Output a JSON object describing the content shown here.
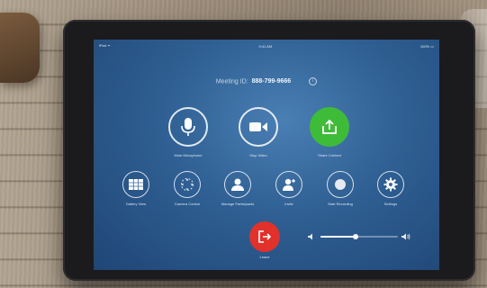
{
  "status": {
    "left": "iPad ᯤ",
    "time": "9:41 AM",
    "battery": "100% ▭"
  },
  "meeting": {
    "label": "Meeting ID:",
    "id": "888-799-9666"
  },
  "primary": [
    {
      "label": "Mute Microphone"
    },
    {
      "label": "Stop Video"
    },
    {
      "label": "Share Content"
    }
  ],
  "secondary": [
    {
      "label": "Gallery View"
    },
    {
      "label": "Camera Control"
    },
    {
      "label": "Manage Participants"
    },
    {
      "label": "Invite"
    },
    {
      "label": "Start Recording"
    },
    {
      "label": "Settings"
    }
  ],
  "leave": {
    "label": "Leave"
  },
  "volume": {
    "level": 0.45
  },
  "colors": {
    "share": "#3fbb3a",
    "leave": "#e0312b",
    "screen": "#2f5f93"
  }
}
